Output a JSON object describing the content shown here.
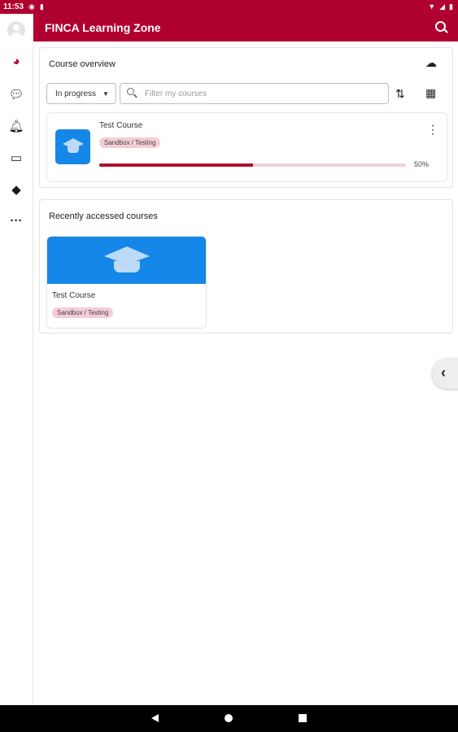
{
  "status_bar": {
    "time": "11:53"
  },
  "app_bar": {
    "title": "FINCA Learning Zone"
  },
  "course_overview": {
    "title": "Course overview",
    "filter_select": "In progress",
    "search_placeholder": "Filter my courses",
    "course": {
      "name": "Test Course",
      "category": "Sandbox / Testing",
      "progress": 50,
      "progress_label": "50%"
    }
  },
  "recent": {
    "title": "Recently accessed courses",
    "course": {
      "name": "Test Course",
      "category": "Sandbox / Testing"
    }
  },
  "colors": {
    "brand": "#b0002f",
    "course_blue": "#1487e8",
    "badge_bg": "#f4cdd6"
  },
  "icons": [
    "avatar",
    "dashboard-icon",
    "messages-icon",
    "bell-icon",
    "calendar-icon",
    "tags-icon",
    "more-icon",
    "search-icon",
    "cloud-download-icon",
    "sort-icon",
    "grid-icon",
    "mortarboard-icon",
    "kebab-icon",
    "chevron-left-icon"
  ]
}
